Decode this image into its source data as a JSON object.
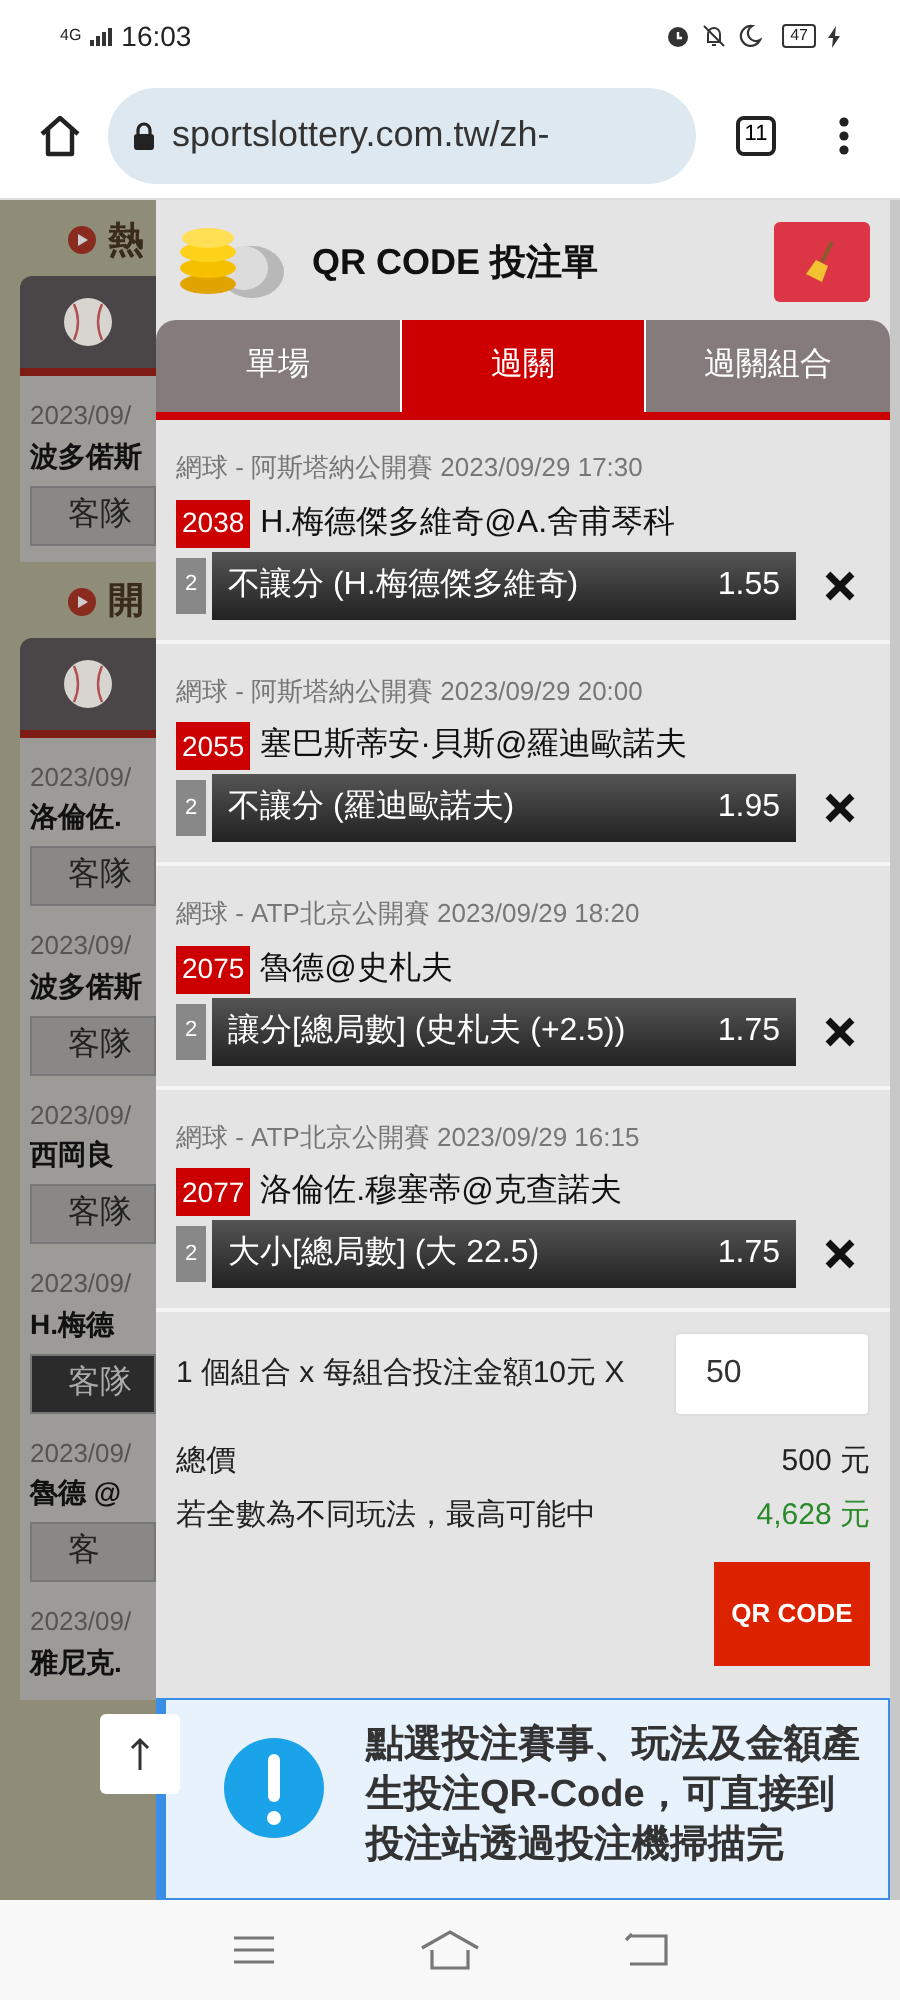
{
  "status_bar": {
    "network": "4G",
    "time": "16:03",
    "battery": "47"
  },
  "browser": {
    "url": "sportslottery.com.tw/zh-",
    "tab_count": "11"
  },
  "background_page": {
    "sections": [
      {
        "heading": "熱",
        "items": [
          {
            "date": "2023/09/",
            "match": "波多偌斯",
            "button": "客隊",
            "selected": false
          }
        ]
      },
      {
        "heading": "開",
        "items": [
          {
            "date": "2023/09/",
            "match": "洛倫佐.",
            "button": "客隊",
            "selected": false
          },
          {
            "date": "2023/09/",
            "match": "波多偌斯",
            "button": "客隊",
            "selected": false
          },
          {
            "date": "2023/09/",
            "match": "西岡良",
            "button": "客隊",
            "selected": false
          },
          {
            "date": "2023/09/",
            "match": "H.梅德",
            "button": "客隊",
            "selected": true
          },
          {
            "date": "2023/09/",
            "match": "魯德 @",
            "button": "客",
            "selected": false
          },
          {
            "date": "2023/09/",
            "match": "雅尼克."
          }
        ]
      }
    ]
  },
  "bet_slip": {
    "title": "QR CODE 投注單",
    "tabs": [
      {
        "label": "單場",
        "selected": false
      },
      {
        "label": "過關",
        "selected": true
      },
      {
        "label": "過關組合",
        "selected": false
      }
    ],
    "bets": [
      {
        "league": "網球 - 阿斯塔納公開賽 2023/09/29 17:30",
        "number": "2038",
        "match": "H.梅德傑多維奇@A.舍甫琴科",
        "count": "2",
        "option": "不讓分 (H.梅德傑多維奇)",
        "odds": "1.55"
      },
      {
        "league": "網球 - 阿斯塔納公開賽 2023/09/29 20:00",
        "number": "2055",
        "match": "塞巴斯蒂安·貝斯@羅迪歐諾夫",
        "count": "2",
        "option": "不讓分 (羅迪歐諾夫)",
        "odds": "1.95"
      },
      {
        "league": "網球 - ATP北京公開賽 2023/09/29 18:20",
        "number": "2075",
        "match": "魯德@史札夫",
        "count": "2",
        "option": "讓分[總局數] (史札夫 (+2.5))",
        "odds": "1.75"
      },
      {
        "league": "網球 - ATP北京公開賽 2023/09/29 16:15",
        "number": "2077",
        "match": "洛倫佐.穆塞蒂@克查諾夫",
        "count": "2",
        "option": "大小[總局數] (大 22.5)",
        "odds": "1.75"
      }
    ],
    "summary": {
      "combo_text": "1 個組合 x 每組合投注金額10元 X",
      "amount": "50",
      "total_label": "總價",
      "total_value": "500 元",
      "max_label": "若全數為不同玩法，最高可能中",
      "max_value": "4,628 元"
    },
    "qr_button": "QR CODE",
    "notice": "點選投注賽事、玩法及金額產生投注QR-Code，可直接到投注站透過投注機掃描完"
  }
}
